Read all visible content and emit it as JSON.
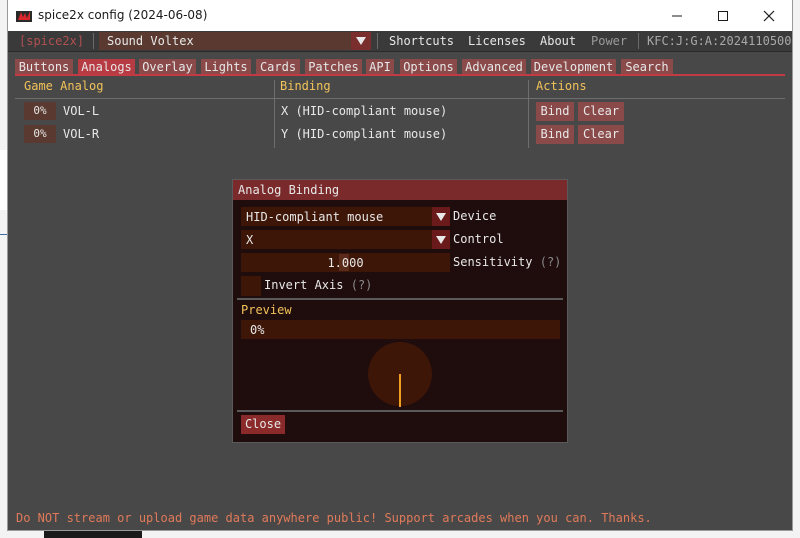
{
  "window": {
    "title": "spice2x config (2024-06-08)",
    "controls": {
      "minimize": "minimize",
      "maximize": "maximize",
      "close": "close"
    }
  },
  "menubar": {
    "brand": "[spice2x]",
    "game": "Sound Voltex",
    "shortcuts": "Shortcuts",
    "licenses": "Licenses",
    "about": "About",
    "power": "Power",
    "version": "KFC:J:G:A:2024110500"
  },
  "tabs": [
    {
      "label": "Buttons",
      "active": false
    },
    {
      "label": "Analogs",
      "active": true
    },
    {
      "label": "Overlay",
      "active": false
    },
    {
      "label": "Lights",
      "active": false
    },
    {
      "label": "Cards",
      "active": false
    },
    {
      "label": "Patches",
      "active": false
    },
    {
      "label": "API",
      "active": false
    },
    {
      "label": "Options",
      "active": false
    },
    {
      "label": "Advanced",
      "active": false
    },
    {
      "label": "Development",
      "active": false
    },
    {
      "label": "Search",
      "active": false
    }
  ],
  "analogs": {
    "headers": {
      "game_analog": "Game Analog",
      "binding": "Binding",
      "actions": "Actions"
    },
    "rows": [
      {
        "value": "0%",
        "name": "VOL-L",
        "binding": "X (HID-compliant mouse)",
        "bind": "Bind",
        "clear": "Clear"
      },
      {
        "value": "0%",
        "name": "VOL-R",
        "binding": "Y (HID-compliant mouse)",
        "bind": "Bind",
        "clear": "Clear"
      }
    ]
  },
  "dialog": {
    "title": "Analog Binding",
    "device_value": "HID-compliant mouse",
    "device_label": "Device",
    "control_value": "X",
    "control_label": "Control",
    "sensitivity_value": "1.000",
    "sensitivity_label": "Sensitivity",
    "invert_label": "Invert Axis",
    "invert_checked": false,
    "help": "(?)",
    "preview_label": "Preview",
    "preview_value": "0%",
    "preview_fraction": 0,
    "close": "Close"
  },
  "footer": "Do NOT stream or upload game data anywhere public! Support arcades when you can. Thanks.",
  "colors": {
    "accent": "#c23b44",
    "header_text": "#f2c35a",
    "footer_text": "#e07a5a",
    "dial": "#3d1608",
    "dial_needle": "#f0a020"
  }
}
